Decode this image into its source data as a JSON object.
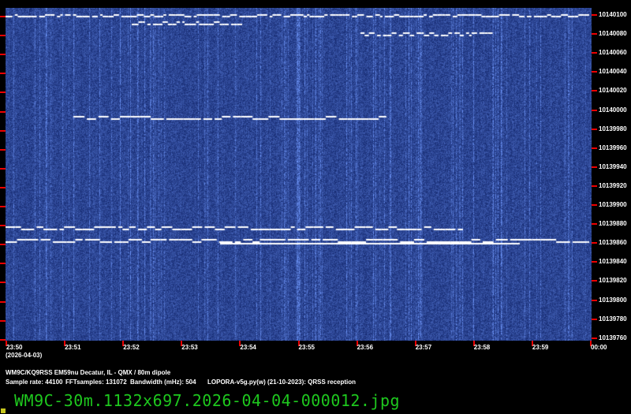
{
  "y_axis": {
    "unit": "Hz",
    "labels": [
      "10140100",
      "10140080",
      "10140060",
      "10140040",
      "10140020",
      "10140000",
      "10139980",
      "10139960",
      "10139940",
      "10139920",
      "10139900",
      "10139880",
      "10139860",
      "10139840",
      "10139820",
      "10139800",
      "10139780",
      "10139760"
    ]
  },
  "x_axis": {
    "labels": [
      "23:50",
      "23:51",
      "23:52",
      "23:53",
      "23:54",
      "23:55",
      "23:56",
      "23:57",
      "23:58",
      "23:59",
      "00:00"
    ],
    "date": "(2026-04-03)"
  },
  "info": {
    "station": "WM9C/KQ9RSS EM59nu Decatur, IL - QMX / 80m dipole",
    "sample_rate": "Sample rate: 44100",
    "fft": "FFTsamples: 131072",
    "bandwidth": "Bandwidth (mHz): 504",
    "software": "LOPORA-v5g.py(w) (21-10-2023): QRSS reception"
  },
  "filename": "WM9C-30m.1132x697.2026-04-04-000012.jpg",
  "colors": {
    "background": "#000000",
    "waterfall": "#10307a",
    "tick": "#e00000",
    "filename": "#1ec81e"
  }
}
